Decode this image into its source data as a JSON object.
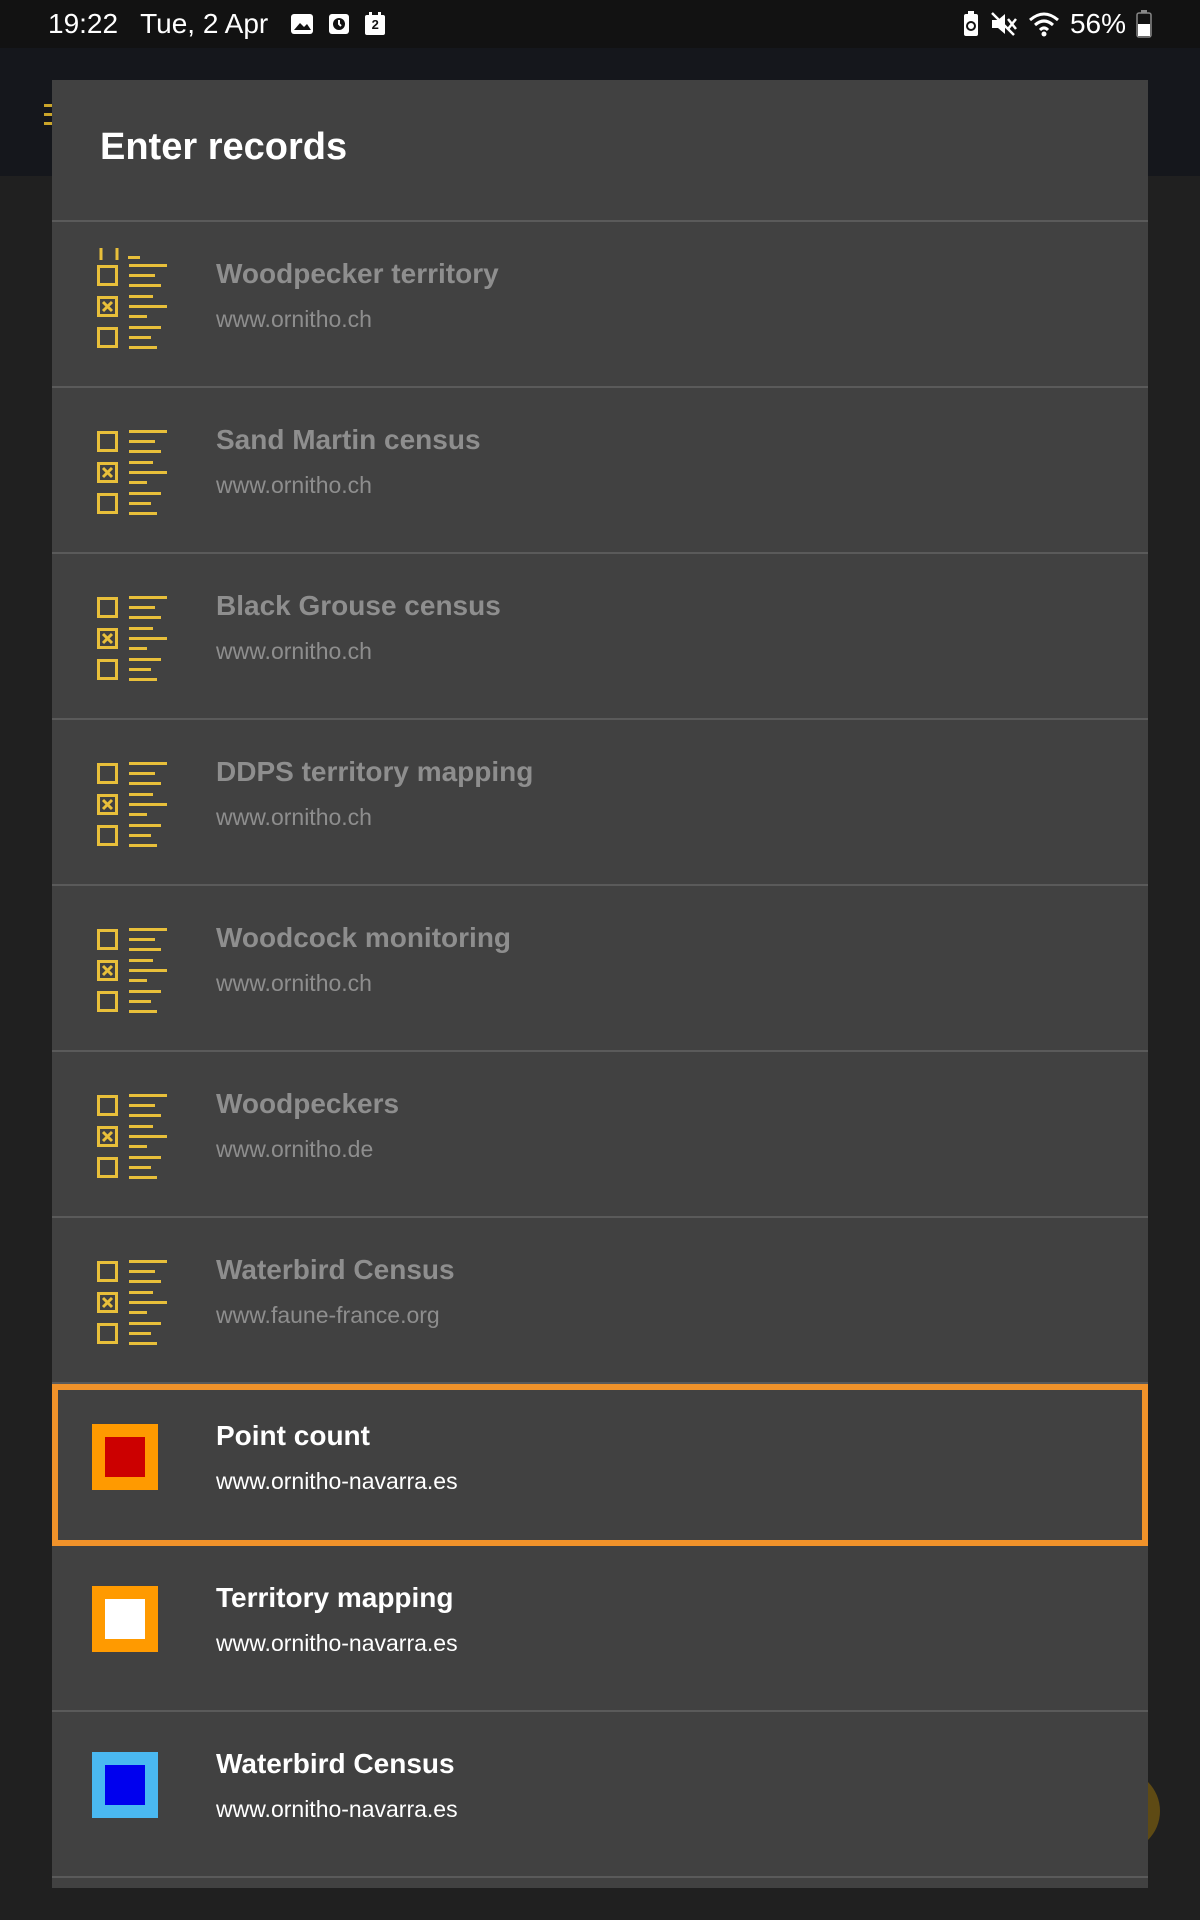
{
  "status_bar": {
    "time": "19:22",
    "date": "Tue, 2 Apr",
    "notif_badge": "2",
    "battery": "56%"
  },
  "dialog": {
    "title": "Enter records"
  },
  "colors": {
    "dialog_bg": "#414141",
    "checklist_icon": "#e8bf3a",
    "selected_outline": "#f0922a"
  },
  "items": [
    {
      "title": "Woodpecker territory",
      "subtitle": "www.ornitho.ch",
      "icon": "checklist-icon",
      "enabled": false
    },
    {
      "title": "Sand Martin census",
      "subtitle": "www.ornitho.ch",
      "icon": "checklist-icon",
      "enabled": false
    },
    {
      "title": "Black Grouse census",
      "subtitle": "www.ornitho.ch",
      "icon": "checklist-icon",
      "enabled": false
    },
    {
      "title": "DDPS territory mapping",
      "subtitle": "www.ornitho.ch",
      "icon": "checklist-icon",
      "enabled": false
    },
    {
      "title": "Woodcock monitoring",
      "subtitle": "www.ornitho.ch",
      "icon": "checklist-icon",
      "enabled": false
    },
    {
      "title": "Woodpeckers",
      "subtitle": "www.ornitho.de",
      "icon": "checklist-icon",
      "enabled": false
    },
    {
      "title": "Waterbird Census",
      "subtitle": "www.faune-france.org",
      "icon": "checklist-icon",
      "enabled": false
    },
    {
      "title": "Point count",
      "subtitle": "www.ornitho-navarra.es",
      "icon": "orange-square-red-fill-icon",
      "enabled": true,
      "selected": true,
      "outer": "#ff9a00",
      "inner": "#cc0000"
    },
    {
      "title": "Territory mapping",
      "subtitle": "www.ornitho-navarra.es",
      "icon": "orange-square-white-fill-icon",
      "enabled": true,
      "outer": "#ff9a00",
      "inner": "#ffffff"
    },
    {
      "title": "Waterbird Census",
      "subtitle": "www.ornitho-navarra.es",
      "icon": "blue-square-icon",
      "enabled": true,
      "outer": "#4ab8f0",
      "inner": "#0000ee"
    }
  ]
}
